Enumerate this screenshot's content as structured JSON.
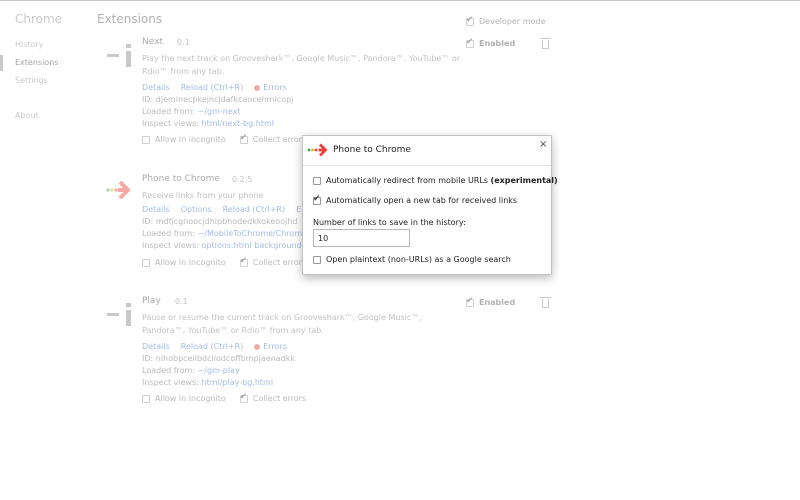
{
  "sidebar": {
    "brand": "Chrome",
    "items": [
      {
        "label": "History"
      },
      {
        "label": "Extensions"
      },
      {
        "label": "Settings"
      },
      {
        "label": "About"
      }
    ]
  },
  "page": {
    "title": "Extensions",
    "developer_mode": "Developer mode"
  },
  "extensions": [
    {
      "name": "Next",
      "version": "0.1",
      "description": "Play the next track on Grooveshark™, Google Music™, Pandora™, YouTube™ or Rdio™ from any tab.",
      "links": [
        "Details",
        "Reload (Ctrl+R)"
      ],
      "errors": "Errors",
      "id_label": "ID:",
      "id": "djeminecpkejncjdafkcaocehmicopj",
      "loaded_label": "Loaded from:",
      "loaded_from": "~/gm-next",
      "inspect_label": "Inspect views:",
      "inspect_views": "html/next-bg.html",
      "allow_incognito": "Allow in incognito",
      "collect_errors": "Collect errors",
      "enabled": "Enabled"
    },
    {
      "name": "Phone to Chrome",
      "version": "0.2.5",
      "description": "Receive links from your phone",
      "links": [
        "Details",
        "Options",
        "Reload (Ctrl+R)",
        "E"
      ],
      "id_label": "ID:",
      "id": "mdfjcgnoocjdhipbhodedkkokeoojhd",
      "loaded_label": "Loaded from:",
      "loaded_from": "~/MobileToChrome/Chrome",
      "inspect_label": "Inspect views:",
      "inspect_views": "options.html",
      "inspect_views_2": "background",
      "allow_incognito": "Allow in incognito",
      "collect_errors": "Collect errors"
    },
    {
      "name": "Play",
      "version": "0.1",
      "description": "Pause or resume the current track on Grooveshark™, Google Music™, Pandora™, YouTube™ or Rdio™ from any tab.",
      "links": [
        "Details",
        "Reload (Ctrl+R)"
      ],
      "errors": "Errors",
      "id_label": "ID:",
      "id": "nihobpceilbdcliodcoffbmpjaenadkk",
      "loaded_label": "Loaded from:",
      "loaded_from": "~/gm-play",
      "inspect_label": "Inspect views:",
      "inspect_views": "html/play-bg.html",
      "allow_incognito": "Allow in incognito",
      "collect_errors": "Collect errors",
      "enabled": "Enabled"
    }
  ],
  "dialog": {
    "title": "Phone to Chrome",
    "close": "×",
    "opt_redirect": "Automatically redirect from mobile URLs",
    "opt_redirect_tag": "(experimental)",
    "opt_redirect_checked": false,
    "opt_newtab": "Automatically open a new tab for received links",
    "opt_newtab_checked": true,
    "links_label": "Number of links to save in the history:",
    "links_value": "10",
    "opt_plaintext": "Open plaintext (non-URLs) as a Google search",
    "opt_plaintext_checked": false
  },
  "colors": {
    "link": "#3a66c4",
    "arrow_red": "#e8423a",
    "arrow_dot_green": "#3aa757",
    "arrow_dot_yellow": "#f2b400"
  }
}
